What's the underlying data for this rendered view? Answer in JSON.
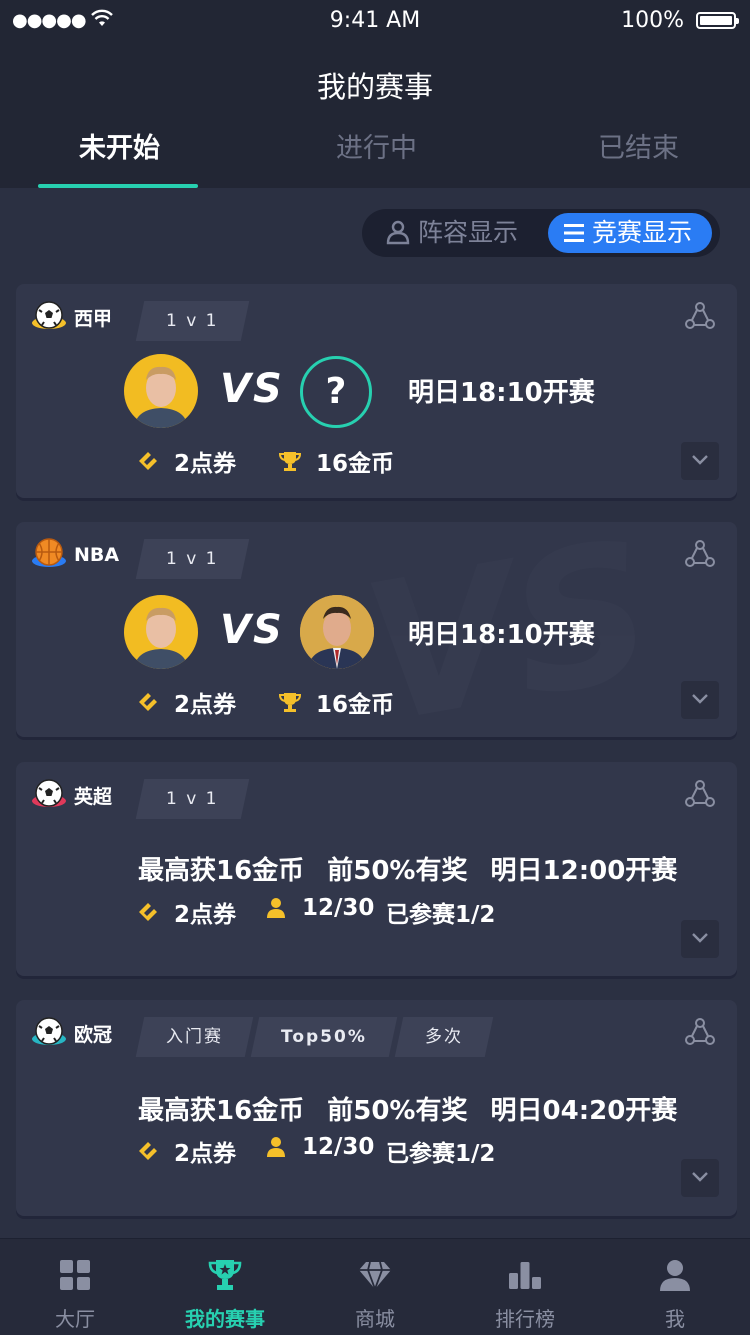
{
  "status_bar": {
    "signal": "●●●●●",
    "time": "9:41 AM",
    "battery": "100%"
  },
  "page": {
    "title": "我的赛事"
  },
  "tabs": [
    "未开始",
    "进行中",
    "已结束"
  ],
  "view_toggle": {
    "lineup": "阵容显示",
    "contest": "竞赛显示"
  },
  "cards": [
    {
      "league": "西甲",
      "tags": [
        "1 v 1"
      ],
      "vs": "VS",
      "opponent_unknown": "?",
      "start": "明日18:10开赛",
      "ticket": "2点券",
      "reward": "16金币"
    },
    {
      "league": "NBA",
      "tags": [
        "1 v 1"
      ],
      "vs": "VS",
      "start": "明日18:10开赛",
      "ticket": "2点券",
      "reward": "16金币",
      "watermark": "VS"
    },
    {
      "league": "英超",
      "tags": [
        "1 v 1"
      ],
      "summary": [
        "最高获16金币",
        "前50%有奖",
        "明日12:00开赛"
      ],
      "ticket": "2点券",
      "players": "12/30",
      "joined": "已参赛1/2"
    },
    {
      "league": "欧冠",
      "tags": [
        "入门赛",
        "Top50%",
        "多次"
      ],
      "summary": [
        "最高获16金币",
        "前50%有奖",
        "明日04:20开赛"
      ],
      "ticket": "2点券",
      "players": "12/30",
      "joined": "已参赛1/2"
    }
  ],
  "nav": [
    "大厅",
    "我的赛事",
    "商城",
    "排行榜",
    "我"
  ],
  "colors": {
    "accent": "#27d0b0",
    "blue": "#2a7cf4",
    "gold": "#f5c02a",
    "bg": "#2b3042",
    "card": "#32374b"
  }
}
